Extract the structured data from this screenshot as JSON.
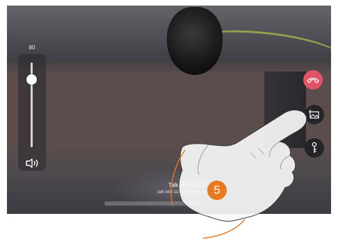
{
  "volume": {
    "value_label": "80",
    "level_percent": 80,
    "speaker_icon": "speaker-volume-icon"
  },
  "controls": {
    "end_call_icon": "end-call-icon",
    "snapshot_icon": "snapshot-icon",
    "door_key_icon": "door-key-icon"
  },
  "call": {
    "talk_time_label": "Talk time: 00:03",
    "talk_with_label": "Talk with 1District01#10 inch gold v                    ip"
  },
  "step": {
    "number": "5"
  },
  "colors": {
    "end_call": "#e05465",
    "control_bg": "#242428",
    "step_badge": "#e8791e"
  }
}
